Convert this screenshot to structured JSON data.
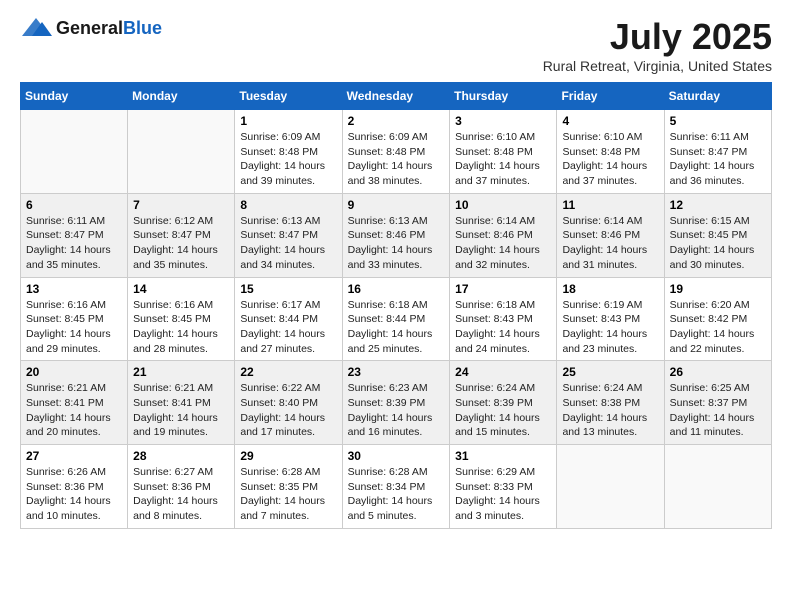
{
  "header": {
    "logo_general": "General",
    "logo_blue": "Blue",
    "month_title": "July 2025",
    "location": "Rural Retreat, Virginia, United States"
  },
  "days_of_week": [
    "Sunday",
    "Monday",
    "Tuesday",
    "Wednesday",
    "Thursday",
    "Friday",
    "Saturday"
  ],
  "weeks": [
    [
      {
        "day": "",
        "sunrise": "",
        "sunset": "",
        "daylight": ""
      },
      {
        "day": "",
        "sunrise": "",
        "sunset": "",
        "daylight": ""
      },
      {
        "day": "1",
        "sunrise": "Sunrise: 6:09 AM",
        "sunset": "Sunset: 8:48 PM",
        "daylight": "Daylight: 14 hours and 39 minutes."
      },
      {
        "day": "2",
        "sunrise": "Sunrise: 6:09 AM",
        "sunset": "Sunset: 8:48 PM",
        "daylight": "Daylight: 14 hours and 38 minutes."
      },
      {
        "day": "3",
        "sunrise": "Sunrise: 6:10 AM",
        "sunset": "Sunset: 8:48 PM",
        "daylight": "Daylight: 14 hours and 37 minutes."
      },
      {
        "day": "4",
        "sunrise": "Sunrise: 6:10 AM",
        "sunset": "Sunset: 8:48 PM",
        "daylight": "Daylight: 14 hours and 37 minutes."
      },
      {
        "day": "5",
        "sunrise": "Sunrise: 6:11 AM",
        "sunset": "Sunset: 8:47 PM",
        "daylight": "Daylight: 14 hours and 36 minutes."
      }
    ],
    [
      {
        "day": "6",
        "sunrise": "Sunrise: 6:11 AM",
        "sunset": "Sunset: 8:47 PM",
        "daylight": "Daylight: 14 hours and 35 minutes."
      },
      {
        "day": "7",
        "sunrise": "Sunrise: 6:12 AM",
        "sunset": "Sunset: 8:47 PM",
        "daylight": "Daylight: 14 hours and 35 minutes."
      },
      {
        "day": "8",
        "sunrise": "Sunrise: 6:13 AM",
        "sunset": "Sunset: 8:47 PM",
        "daylight": "Daylight: 14 hours and 34 minutes."
      },
      {
        "day": "9",
        "sunrise": "Sunrise: 6:13 AM",
        "sunset": "Sunset: 8:46 PM",
        "daylight": "Daylight: 14 hours and 33 minutes."
      },
      {
        "day": "10",
        "sunrise": "Sunrise: 6:14 AM",
        "sunset": "Sunset: 8:46 PM",
        "daylight": "Daylight: 14 hours and 32 minutes."
      },
      {
        "day": "11",
        "sunrise": "Sunrise: 6:14 AM",
        "sunset": "Sunset: 8:46 PM",
        "daylight": "Daylight: 14 hours and 31 minutes."
      },
      {
        "day": "12",
        "sunrise": "Sunrise: 6:15 AM",
        "sunset": "Sunset: 8:45 PM",
        "daylight": "Daylight: 14 hours and 30 minutes."
      }
    ],
    [
      {
        "day": "13",
        "sunrise": "Sunrise: 6:16 AM",
        "sunset": "Sunset: 8:45 PM",
        "daylight": "Daylight: 14 hours and 29 minutes."
      },
      {
        "day": "14",
        "sunrise": "Sunrise: 6:16 AM",
        "sunset": "Sunset: 8:45 PM",
        "daylight": "Daylight: 14 hours and 28 minutes."
      },
      {
        "day": "15",
        "sunrise": "Sunrise: 6:17 AM",
        "sunset": "Sunset: 8:44 PM",
        "daylight": "Daylight: 14 hours and 27 minutes."
      },
      {
        "day": "16",
        "sunrise": "Sunrise: 6:18 AM",
        "sunset": "Sunset: 8:44 PM",
        "daylight": "Daylight: 14 hours and 25 minutes."
      },
      {
        "day": "17",
        "sunrise": "Sunrise: 6:18 AM",
        "sunset": "Sunset: 8:43 PM",
        "daylight": "Daylight: 14 hours and 24 minutes."
      },
      {
        "day": "18",
        "sunrise": "Sunrise: 6:19 AM",
        "sunset": "Sunset: 8:43 PM",
        "daylight": "Daylight: 14 hours and 23 minutes."
      },
      {
        "day": "19",
        "sunrise": "Sunrise: 6:20 AM",
        "sunset": "Sunset: 8:42 PM",
        "daylight": "Daylight: 14 hours and 22 minutes."
      }
    ],
    [
      {
        "day": "20",
        "sunrise": "Sunrise: 6:21 AM",
        "sunset": "Sunset: 8:41 PM",
        "daylight": "Daylight: 14 hours and 20 minutes."
      },
      {
        "day": "21",
        "sunrise": "Sunrise: 6:21 AM",
        "sunset": "Sunset: 8:41 PM",
        "daylight": "Daylight: 14 hours and 19 minutes."
      },
      {
        "day": "22",
        "sunrise": "Sunrise: 6:22 AM",
        "sunset": "Sunset: 8:40 PM",
        "daylight": "Daylight: 14 hours and 17 minutes."
      },
      {
        "day": "23",
        "sunrise": "Sunrise: 6:23 AM",
        "sunset": "Sunset: 8:39 PM",
        "daylight": "Daylight: 14 hours and 16 minutes."
      },
      {
        "day": "24",
        "sunrise": "Sunrise: 6:24 AM",
        "sunset": "Sunset: 8:39 PM",
        "daylight": "Daylight: 14 hours and 15 minutes."
      },
      {
        "day": "25",
        "sunrise": "Sunrise: 6:24 AM",
        "sunset": "Sunset: 8:38 PM",
        "daylight": "Daylight: 14 hours and 13 minutes."
      },
      {
        "day": "26",
        "sunrise": "Sunrise: 6:25 AM",
        "sunset": "Sunset: 8:37 PM",
        "daylight": "Daylight: 14 hours and 11 minutes."
      }
    ],
    [
      {
        "day": "27",
        "sunrise": "Sunrise: 6:26 AM",
        "sunset": "Sunset: 8:36 PM",
        "daylight": "Daylight: 14 hours and 10 minutes."
      },
      {
        "day": "28",
        "sunrise": "Sunrise: 6:27 AM",
        "sunset": "Sunset: 8:36 PM",
        "daylight": "Daylight: 14 hours and 8 minutes."
      },
      {
        "day": "29",
        "sunrise": "Sunrise: 6:28 AM",
        "sunset": "Sunset: 8:35 PM",
        "daylight": "Daylight: 14 hours and 7 minutes."
      },
      {
        "day": "30",
        "sunrise": "Sunrise: 6:28 AM",
        "sunset": "Sunset: 8:34 PM",
        "daylight": "Daylight: 14 hours and 5 minutes."
      },
      {
        "day": "31",
        "sunrise": "Sunrise: 6:29 AM",
        "sunset": "Sunset: 8:33 PM",
        "daylight": "Daylight: 14 hours and 3 minutes."
      },
      {
        "day": "",
        "sunrise": "",
        "sunset": "",
        "daylight": ""
      },
      {
        "day": "",
        "sunrise": "",
        "sunset": "",
        "daylight": ""
      }
    ]
  ]
}
